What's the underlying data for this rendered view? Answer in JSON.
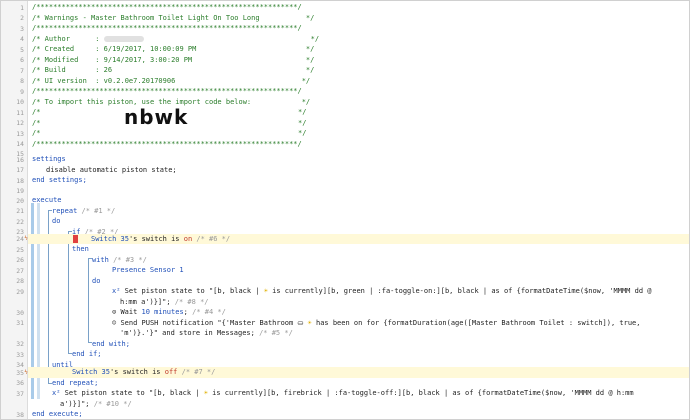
{
  "gutter": {
    "line_numbers": [
      "1",
      "2",
      "3",
      "4",
      "5",
      "6",
      "7",
      "8",
      "9",
      "10",
      "11",
      "12",
      "13",
      "14",
      "15",
      "16",
      "17",
      "18",
      "19",
      "20",
      "21",
      "22",
      "23",
      "24",
      "25",
      "26",
      "27",
      "28",
      "29",
      "30",
      "31",
      "32",
      "33",
      "34",
      "35",
      "36",
      "37",
      "38"
    ]
  },
  "header": {
    "border": "/**************************************************************/",
    "title": "/* Warnings - Master Bathroom Toilet Light On Too Long           */",
    "author_label": "/* Author      : ",
    "author_end": "*/",
    "created": "/* Created     : 6/19/2017, 10:00:09 PM                          */",
    "modified": "/* Modified    : 9/14/2017, 3:00:20 PM                           */",
    "build": "/* Build       : 26                                              */",
    "ui_version": "/* UI version  : v0.2.0e7.20170906                              */",
    "import_line": "/* To import this piston, use the import code below:            */",
    "blank_open": "/*",
    "blank_close": "*/",
    "import_code": "nbwk"
  },
  "code": {
    "settings": "settings",
    "disable_auto": "disable automatic piston state;",
    "end_settings": "end settings;",
    "execute": "execute",
    "repeat": "repeat",
    "repeat_id": " /* #1 */",
    "do": "do",
    "if": "if",
    "if_id": " /* #2 */",
    "cond1_device": "Switch 35",
    "cond1_attr": "'s switch is ",
    "cond1_val": "on",
    "cond1_id": " /* #6 */",
    "then": "then",
    "with": "with",
    "with_id": " /* #3 */",
    "presence": "Presence Sensor 1",
    "do2": "do",
    "set_state1_a": "Set piston state to \"[b, black | ",
    "set_state1_b": " is currently][b, green | :fa-toggle-on:][b, black | as of {formatDateTime($now, 'MMMM dd @",
    "set_state1_c": "h:mm a')}]\";",
    "set_state1_id": " /* #8 */",
    "wait_a": "Wait ",
    "wait_val": "10 minutes",
    "wait_b": ";",
    "wait_id": " /* #4 */",
    "push_a": "Send PUSH notification \"{'Master Bathroom ",
    "push_b": " has been on for {formatDuration(age([Master Bathroom Toilet : switch]), true,",
    "push_c": "'m')}.'}\" and store in Messages;",
    "push_id": " /* #5 */",
    "end_with": "end with;",
    "end_if": "end if;",
    "until": "until",
    "cond2_device": "Switch 35",
    "cond2_attr": "'s switch is ",
    "cond2_val": "off",
    "cond2_id": " /* #7 */",
    "end_repeat": "end repeat;",
    "set_state2_a": "Set piston state to \"[b, black | ",
    "set_state2_b": " is currently][b, firebrick | :fa-toggle-off:][b, black | as of {formatDateTime($now, 'MMMM dd @ h:mm",
    "set_state2_c": "a')}]\";",
    "set_state2_id": " /* #10 */",
    "end_execute": "end execute;"
  },
  "icons": {
    "x2": "x²",
    "clock": "⊙",
    "chat": "☺",
    "bulb": "☀",
    "toilet": "⛀"
  },
  "colors": {
    "comment": "#2a7d2a",
    "keyword": "#1f4fb8",
    "value": "#c0392b",
    "line_highlight": "#fff9d8",
    "blue_bar": "#a9cbe9"
  }
}
